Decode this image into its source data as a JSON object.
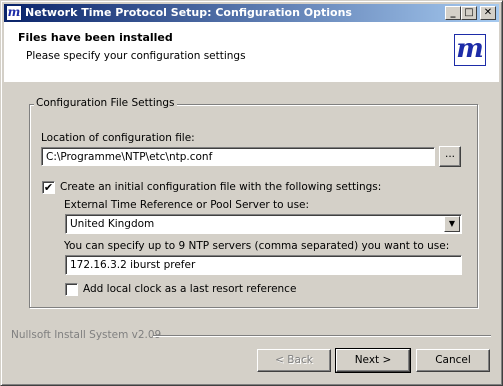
{
  "window": {
    "title": "Network Time Protocol Setup: Configuration Options",
    "icon_text": "m",
    "buttons": {
      "minimize": "_",
      "maximize": "□",
      "close": "✕"
    }
  },
  "header": {
    "title": "Files have been installed",
    "subtitle": "Please specify your configuration settings",
    "logo_text": "m"
  },
  "group": {
    "title": "Configuration File Settings",
    "location_label": "Location of configuration file:",
    "location_value": "C:\\Programme\\NTP\\etc\\ntp.conf",
    "browse_label": "...",
    "create_label": "Create an initial configuration file with the following settings:",
    "create_checked": "✔",
    "server_label": "External Time Reference or Pool Server to use:",
    "server_value": "United Kingdom",
    "servers_label": "You can specify up to 9 NTP servers (comma separated) you want to use:",
    "servers_value": "172.16.3.2 iburst prefer",
    "local_clock_label": "Add local clock as a last resort reference",
    "local_clock_checked": ""
  },
  "footer": {
    "branding": "Nullsoft Install System v2.09",
    "back_label": "< Back",
    "next_label": "Next >",
    "cancel_label": "Cancel"
  }
}
